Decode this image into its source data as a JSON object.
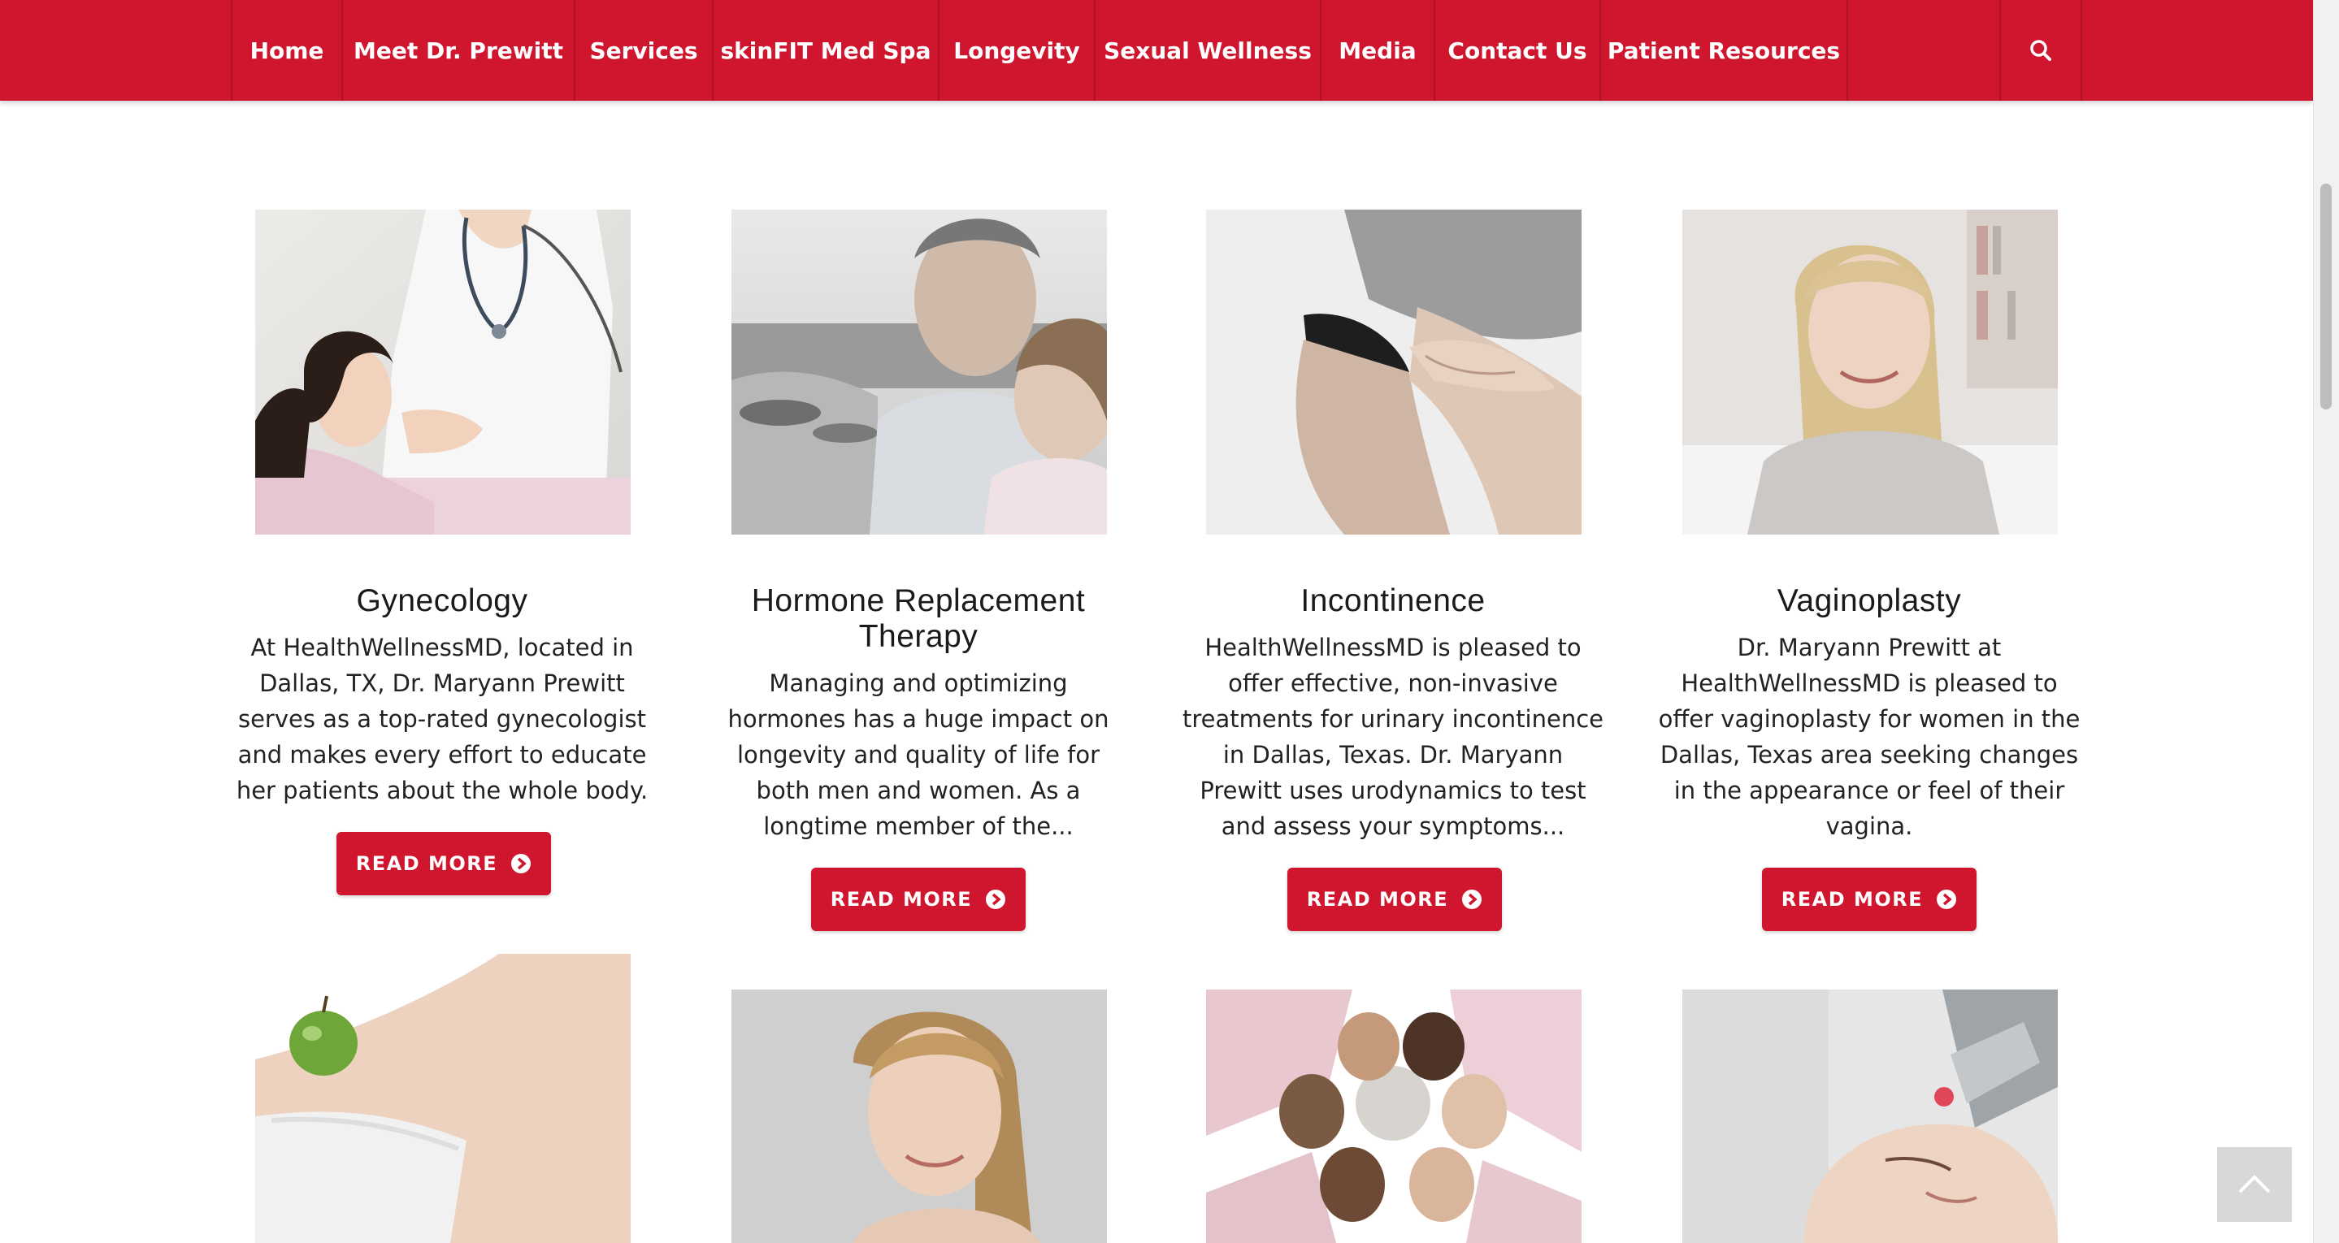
{
  "nav": {
    "items": [
      {
        "label": "Home"
      },
      {
        "label": "Meet Dr. Prewitt"
      },
      {
        "label": "Services"
      },
      {
        "label": "skinFIT Med Spa"
      },
      {
        "label": "Longevity"
      },
      {
        "label": "Sexual Wellness"
      },
      {
        "label": "Media"
      },
      {
        "label": "Contact Us"
      },
      {
        "label": "Patient Resources"
      }
    ],
    "search_icon": "search-icon",
    "brand_color": "#d0162f"
  },
  "cards": [
    {
      "title": "Gynecology",
      "text": "At HealthWellnessMD, located in Dallas, TX, Dr. Maryann Prewitt serves as a top-rated gynecologist and makes every effort to educate her patients about the whole body.",
      "button": "READ MORE"
    },
    {
      "title": "Hormone Replacement Therapy",
      "text": "Managing and optimizing hormones has a huge impact on longevity and quality of life for both men and women. As a longtime member of the...",
      "button": "READ MORE"
    },
    {
      "title": "Incontinence",
      "text": "HealthWellnessMD is pleased to offer effective, non-invasive treatments for urinary incontinence in Dallas, Texas. Dr. Maryann Prewitt uses urodynamics to test and assess your symptoms...",
      "button": "READ MORE"
    },
    {
      "title": "Vaginoplasty",
      "text": "Dr. Maryann Prewitt at HealthWellnessMD is pleased to offer vaginoplasty for women in the Dallas, Texas area seeking changes in the appearance or feel of their vagina.",
      "button": "READ MORE"
    }
  ],
  "back_to_top_icon": "chevron-up-icon"
}
